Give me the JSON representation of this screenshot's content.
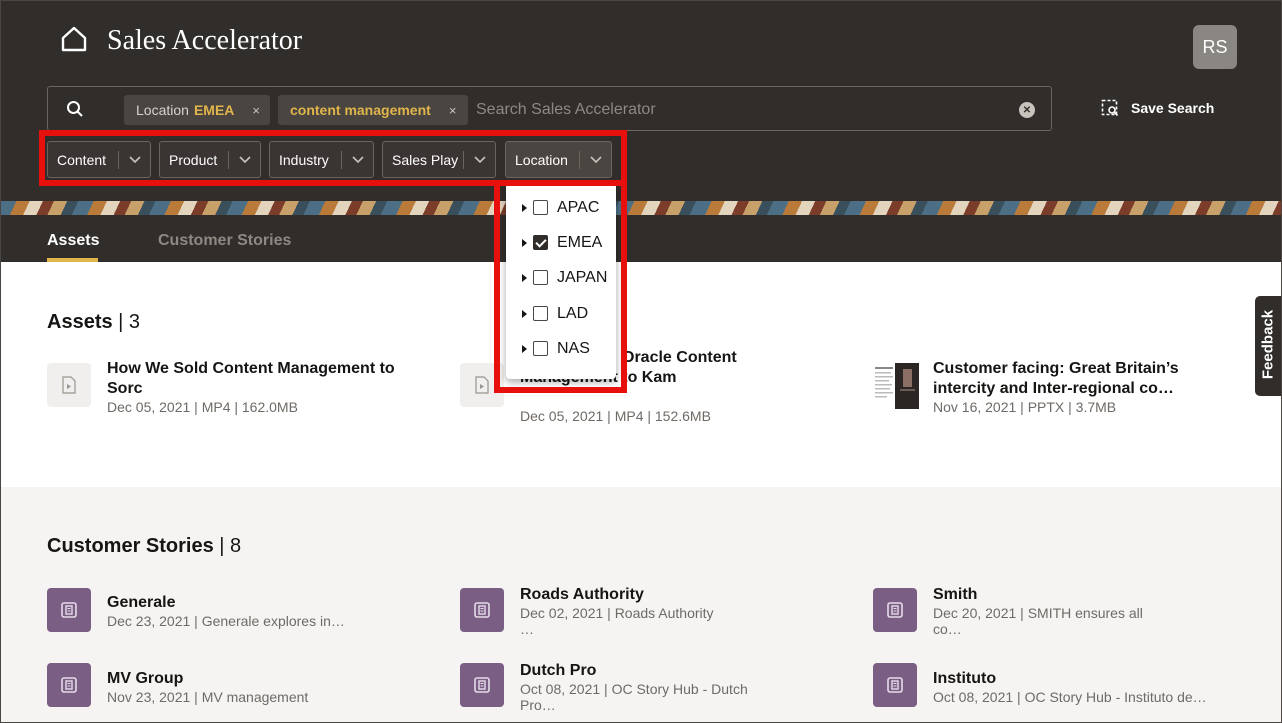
{
  "header": {
    "app_title": "Sales Accelerator",
    "avatar_initials": "RS",
    "save_search_label": "Save Search"
  },
  "search": {
    "chip_location_label": "Location",
    "chip_location_value": "EMEA",
    "chip_content_value": "content management",
    "chip_close": "×",
    "placeholder": "Search Sales Accelerator"
  },
  "filters": [
    "Content",
    "Product",
    "Industry",
    "Sales Play",
    "Location"
  ],
  "location_options": [
    {
      "label": "APAC",
      "checked": false
    },
    {
      "label": "EMEA",
      "checked": true
    },
    {
      "label": "JAPAN",
      "checked": false
    },
    {
      "label": "LAD",
      "checked": false
    },
    {
      "label": "NAS",
      "checked": false
    }
  ],
  "tabs": [
    "Assets",
    "Customer Stories"
  ],
  "assets": {
    "title": "Assets",
    "count": "| 3",
    "items": [
      {
        "title_line1": "How We Sold Content Management to",
        "title_line2": "Sorc",
        "meta": "Dec 05, 2021 | MP4 | 162.0MB"
      },
      {
        "title_line1": "Oracle Content",
        "title_line2": "Management to Kam",
        "meta": "Dec 05, 2021 | MP4 | 152.6MB"
      },
      {
        "title_line1": "Customer facing: Great Britain’s",
        "title_line2": "intercity and Inter-regional co…",
        "meta": "Nov 16, 2021 | PPTX | 3.7MB"
      }
    ]
  },
  "stories": {
    "title": "Customer Stories",
    "count": "| 8",
    "items": [
      {
        "title": "Generale",
        "meta1": "Dec 23, 2021 | Generale explores in…",
        "meta2": ""
      },
      {
        "title": "Roads Authority",
        "meta1": "Dec 02, 2021 | Roads Authority",
        "meta2": "…"
      },
      {
        "title": "Smith",
        "meta1": "Dec 20, 2021 | SMITH ensures all",
        "meta2": "co…"
      },
      {
        "title": "MV Group",
        "meta1": "Nov 23, 2021 | MV management",
        "meta2": ""
      },
      {
        "title": "Dutch Pro",
        "meta1": "Oct 08, 2021 | OC Story Hub - Dutch",
        "meta2": "Pro…"
      },
      {
        "title": "Instituto",
        "meta1": "Oct 08, 2021 | OC Story Hub - Instituto de…",
        "meta2": ""
      }
    ]
  },
  "feedback_label": "Feedback",
  "colors": {
    "header_bg": "#312d2a",
    "accent": "#e0b54b",
    "highlight": "#e8100c",
    "story_icon": "#7a5e83"
  }
}
